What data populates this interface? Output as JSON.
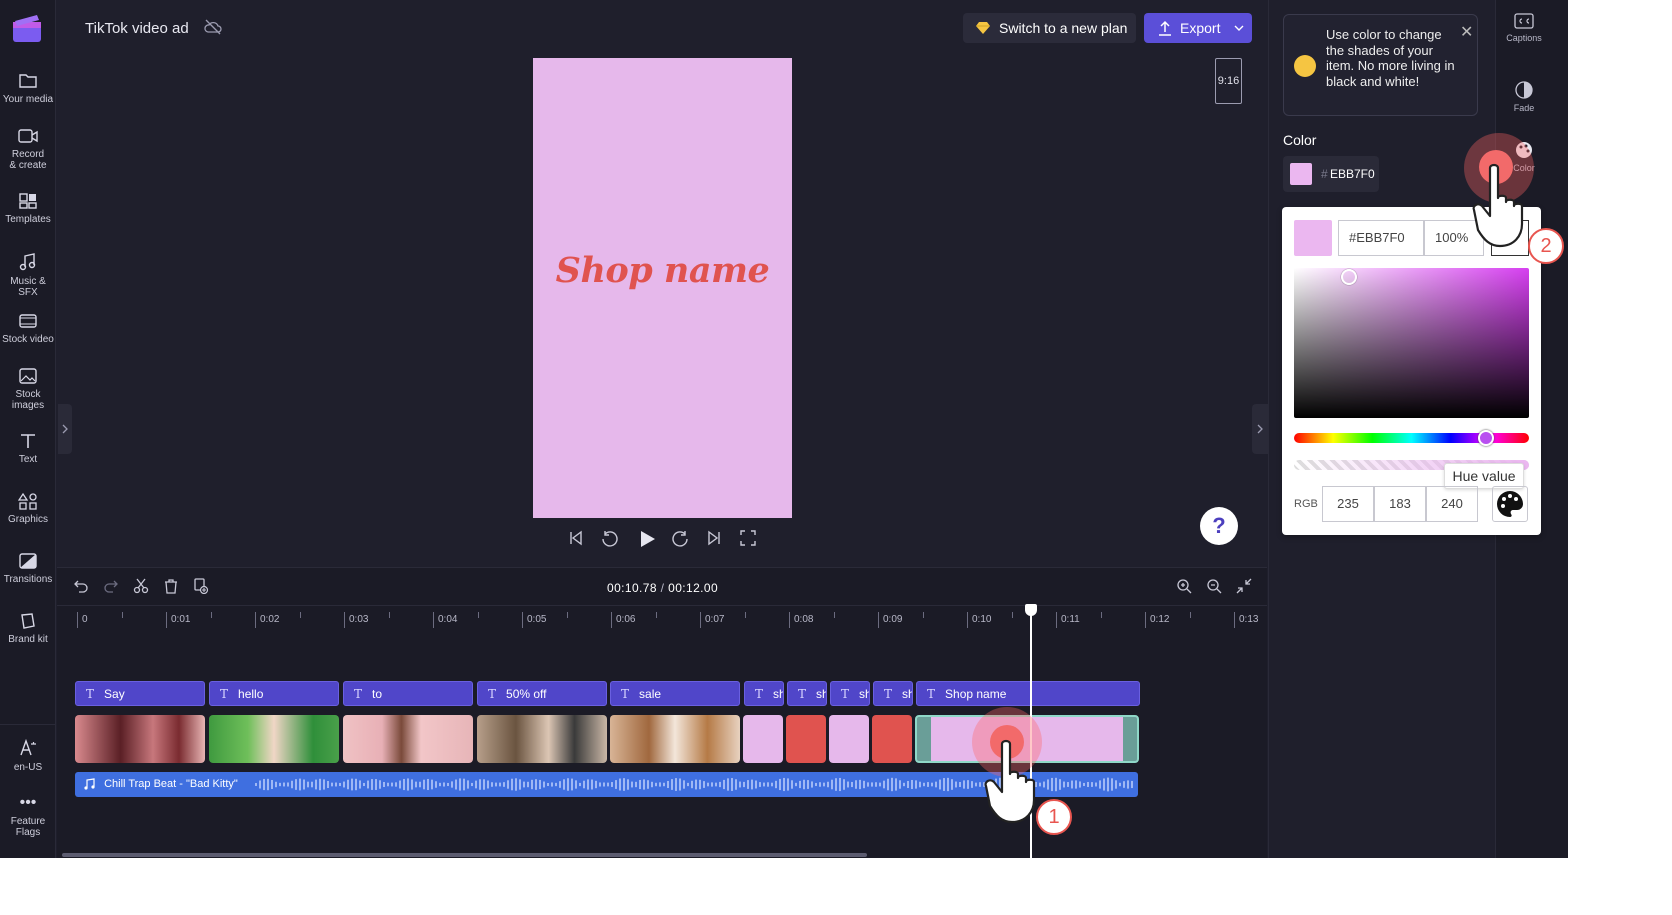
{
  "project": {
    "title": "TikTok video ad"
  },
  "header": {
    "plan_label": "Switch to a new plan",
    "export_label": "Export"
  },
  "sidebar": {
    "items": [
      {
        "label": "Your media"
      },
      {
        "label": "Record & create"
      },
      {
        "label": "Templates"
      },
      {
        "label": "Music & SFX"
      },
      {
        "label": "Stock video"
      },
      {
        "label": "Stock images"
      },
      {
        "label": "Text"
      },
      {
        "label": "Graphics"
      },
      {
        "label": "Transitions"
      },
      {
        "label": "Brand kit"
      }
    ],
    "bottom": [
      {
        "label": "en-US"
      },
      {
        "label": "Feature Flags"
      }
    ]
  },
  "preview": {
    "text": "Shop name",
    "aspect_ratio": "9:16",
    "background": "#EBB7F0",
    "text_color": "#E0534F"
  },
  "timeline": {
    "current": "00:10.78",
    "total": "00:12.00",
    "ticks": [
      "0",
      "0:01",
      "0:02",
      "0:03",
      "0:04",
      "0:05",
      "0:06",
      "0:07",
      "0:08",
      "0:09",
      "0:10",
      "0:11",
      "0:12",
      "0:13"
    ],
    "text_clips": [
      "Say",
      "hello",
      "to",
      "50% off",
      "sale",
      "sh",
      "sh",
      "sh",
      "sh",
      "Shop name"
    ],
    "audio_label": "Chill Trap Beat - \"Bad Kitty\""
  },
  "right_panel": {
    "tip": "Use color to change the shades of your item. No more living in black and white!",
    "color_label": "Color",
    "hash": "#",
    "hex": "EBB7F0"
  },
  "right_rail": [
    {
      "label": "Captions"
    },
    {
      "label": "Fade"
    },
    {
      "label": "Color"
    }
  ],
  "picker": {
    "hex": "#EBB7F0",
    "opacity": "100%",
    "tooltip": "Hue value",
    "rgb_label": "RGB",
    "r": "235",
    "g": "183",
    "b": "240"
  },
  "annotations": {
    "step1": "1",
    "step2": "2"
  },
  "colors": {
    "accent": "#5B4FD8",
    "text_clip": "#5046C9",
    "audio": "#3F6FE0",
    "panel_bg": "#1F1F2C"
  }
}
